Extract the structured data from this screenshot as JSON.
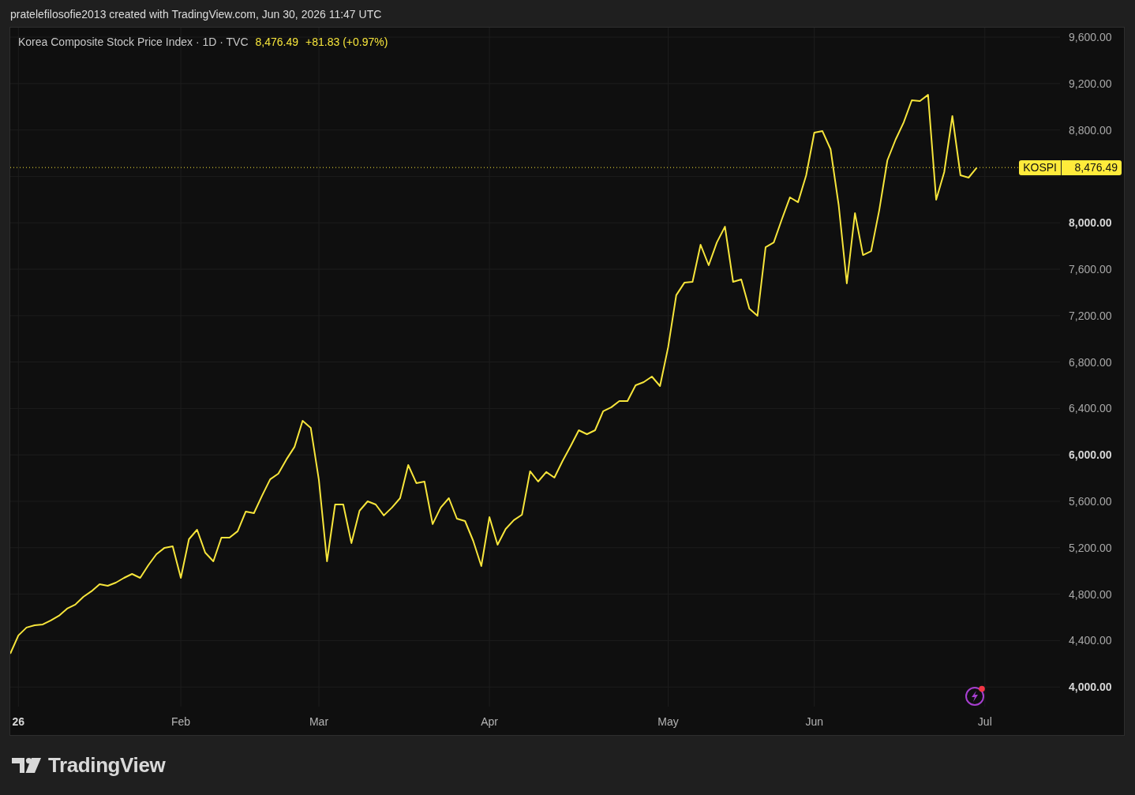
{
  "caption": {
    "text": "pratelefilosofie2013 created with TradingView.com, Jun 30, 2026 11:47 UTC"
  },
  "legend": {
    "symbol": "Korea Composite Stock Price Index · 1D · TVC",
    "last_price": "8,476.49",
    "change": "+81.83 (+0.97%)"
  },
  "chart": {
    "chart_data": {
      "type": "line",
      "categories": [
        null,
        "26",
        null,
        null,
        null,
        null,
        null,
        null,
        null,
        null,
        null,
        null,
        null,
        null,
        null,
        null,
        null,
        null,
        null,
        null,
        null,
        "Feb",
        null,
        null,
        null,
        null,
        null,
        null,
        null,
        null,
        null,
        null,
        null,
        null,
        null,
        null,
        null,
        null,
        "Mar",
        null,
        null,
        null,
        null,
        null,
        null,
        null,
        null,
        null,
        null,
        null,
        null,
        null,
        null,
        null,
        null,
        null,
        null,
        null,
        null,
        "Apr",
        null,
        null,
        null,
        null,
        null,
        null,
        null,
        null,
        null,
        null,
        null,
        null,
        null,
        null,
        null,
        null,
        null,
        null,
        null,
        null,
        null,
        "May",
        null,
        null,
        null,
        null,
        null,
        null,
        null,
        null,
        null,
        null,
        null,
        null,
        null,
        null,
        null,
        null,
        null,
        "Jun",
        null,
        null,
        null,
        null,
        null,
        null,
        null,
        null,
        null,
        null,
        null,
        null,
        null,
        null,
        null,
        null,
        null,
        null,
        null,
        null,
        "Jul"
      ],
      "series": [
        {
          "name": "KOSPI",
          "color": "#f7e53b",
          "values": [
            4287,
            4444,
            4512,
            4532,
            4539,
            4573,
            4614,
            4675,
            4709,
            4777,
            4825,
            4886,
            4872,
            4899,
            4940,
            4974,
            4940,
            5049,
            5144,
            5199,
            5212,
            4940,
            5273,
            5355,
            5158,
            5083,
            5287,
            5287,
            5342,
            5512,
            5498,
            5648,
            5790,
            5838,
            5961,
            6069,
            6294,
            6233,
            5784,
            5083,
            5573,
            5573,
            5240,
            5518,
            5600,
            5573,
            5478,
            5546,
            5627,
            5913,
            5757,
            5770,
            5403,
            5546,
            5627,
            5450,
            5430,
            5260,
            5042,
            5464,
            5226,
            5362,
            5437,
            5484,
            5859,
            5770,
            5852,
            5804,
            5947,
            6076,
            6212,
            6178,
            6212,
            6376,
            6410,
            6464,
            6464,
            6600,
            6627,
            6675,
            6593,
            6927,
            7376,
            7484,
            7491,
            7811,
            7634,
            7831,
            7967,
            7491,
            7512,
            7260,
            7199,
            7790,
            7831,
            8029,
            8219,
            8178,
            8410,
            8777,
            8790,
            8634,
            8151,
            7478,
            8083,
            7722,
            7756,
            8110,
            8539,
            8716,
            8865,
            9056,
            9049,
            9103,
            8199,
            8437,
            8920,
            8410,
            8389,
            8476,
            null
          ]
        }
      ],
      "ylim": [
        3831,
        9682
      ],
      "grid": true,
      "ref_lines": [
        {
          "axis": "y",
          "value": 8476.49,
          "label": "8,476.49",
          "color": "#f7e53b"
        }
      ],
      "yticks": [
        {
          "value": 4000,
          "label": "4,000.00"
        },
        {
          "value": 4400,
          "label": "4,400.00"
        },
        {
          "value": 4800,
          "label": "4,800.00"
        },
        {
          "value": 5200,
          "label": "5,200.00"
        },
        {
          "value": 5600,
          "label": "5,600.00"
        },
        {
          "value": 6000,
          "label": "6,000.00"
        },
        {
          "value": 6400,
          "label": "6,400.00"
        },
        {
          "value": 6800,
          "label": "6,800.00"
        },
        {
          "value": 7200,
          "label": "7,200.00"
        },
        {
          "value": 7600,
          "label": "7,600.00"
        },
        {
          "value": 8000,
          "label": "8,000.00"
        },
        {
          "value": 8800,
          "label": "8,800.00"
        },
        {
          "value": 9200,
          "label": "9,200.00"
        },
        {
          "value": 9600,
          "label": "9,600.00"
        }
      ]
    }
  },
  "footer": {
    "brand": "TradingView"
  }
}
